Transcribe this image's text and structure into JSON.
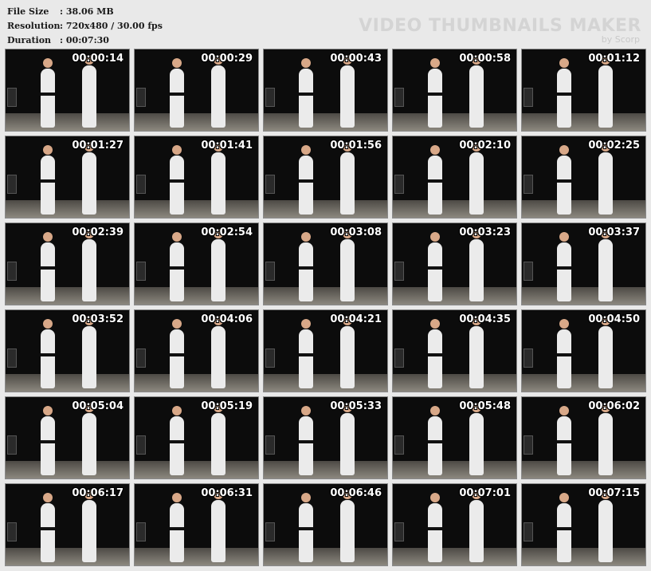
{
  "info": {
    "file_size_label": "File Size",
    "file_size_value": ":   38.06 MB",
    "resolution_label": "Resolution",
    "resolution_value": ":   720x480 / 30.00 fps",
    "duration_label": "Duration",
    "duration_value": ":   00:07:30"
  },
  "brand": {
    "title": "VIDEO THUMBNAILS MAKER",
    "subtitle": "by Scorp"
  },
  "thumbnails": [
    "00:00:14",
    "00:00:29",
    "00:00:43",
    "00:00:58",
    "00:01:12",
    "00:01:27",
    "00:01:41",
    "00:01:56",
    "00:02:10",
    "00:02:25",
    "00:02:39",
    "00:02:54",
    "00:03:08",
    "00:03:23",
    "00:03:37",
    "00:03:52",
    "00:04:06",
    "00:04:21",
    "00:04:35",
    "00:04:50",
    "00:05:04",
    "00:05:19",
    "00:05:33",
    "00:05:48",
    "00:06:02",
    "00:06:17",
    "00:06:31",
    "00:06:46",
    "00:07:01",
    "00:07:15"
  ]
}
